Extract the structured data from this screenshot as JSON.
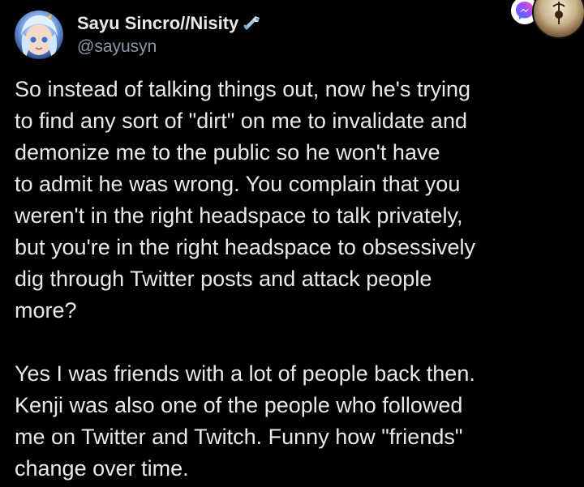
{
  "tweet": {
    "author": {
      "display_name": "Sayu Sincro//Nisity",
      "handle": "@sayusyn",
      "badge_icon": "sparkle-wrench-icon",
      "avatar_icon": "avatar-anime-character"
    },
    "corner_icons": [
      "messenger-icon",
      "app-avatar-icon"
    ],
    "paragraphs": [
      {
        "lines": [
          "So instead of talking things out, now he's trying",
          "to find any sort of \"dirt\" on me to invalidate and",
          "demonize me to the public so he won't have",
          "to admit he was wrong. You complain that you",
          "weren't in the right headspace to talk privately,",
          "but you're in the right headspace to obsessively",
          "dig through Twitter posts and attack people",
          "more?"
        ]
      },
      {
        "lines": [
          "Yes I was friends with a lot of people back then.",
          "Kenji was also one of the people who followed",
          "me on Twitter and Twitch. Funny how \"friends\"",
          "change over time."
        ]
      }
    ]
  },
  "colors": {
    "background": "#000000",
    "text_primary": "#e7e9ea",
    "text_secondary": "#8b98a5",
    "messenger_accent": "#7b5cff"
  }
}
